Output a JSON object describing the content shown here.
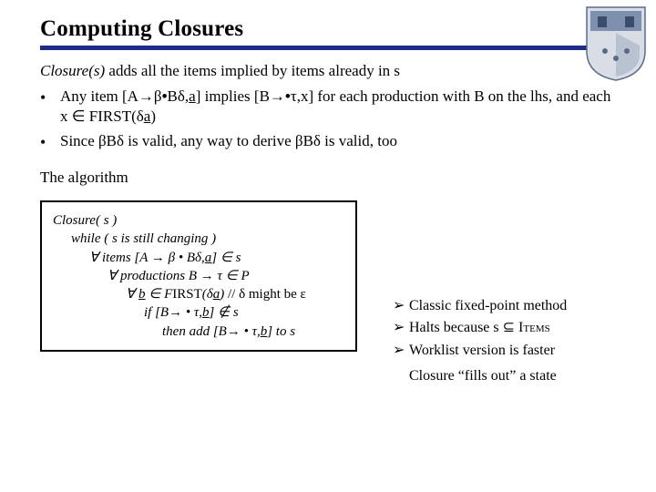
{
  "title": "Computing Closures",
  "intro_lead": "Closure(s)",
  "intro_rest": "  adds all the items implied by items already in s",
  "bullet1_a": "Any item [A→β",
  "bullet1_b": "•",
  "bullet1_c": "Bδ,",
  "bullet1_d": "a",
  "bullet1_e": "] implies [B→",
  "bullet1_f": "•",
  "bullet1_g": "τ,x] for each production with B on the lhs,  and each x ∈ FIRST(δ",
  "bullet1_h": "a",
  "bullet1_i": ")",
  "bullet2": "Since βBδ is valid, any way to derive βBδ is valid, too",
  "algo_heading": "The algorithm",
  "alg": {
    "l1": "Closure( s )",
    "l2": "while ( s is still changing )",
    "l3a": "∀ items [A → β • Bδ,",
    "l3b": "a",
    "l3c": "] ∈ s",
    "l4": "∀ productions B → τ ∈ P",
    "l5a": "∀ ",
    "l5b": "b",
    "l5c": " ∈ F",
    "l5d": "IRST",
    "l5e": "(δ",
    "l5f": "a",
    "l5g": ") ",
    "l5h": "// δ might be ε",
    "l6a": "if [B→ • τ,",
    "l6b": "b",
    "l6c": "] ∉ s",
    "l7a": "then add [B→ • τ,",
    "l7b": "b",
    "l7c": "] to s"
  },
  "notes": {
    "n1": "Classic fixed-point method",
    "n2a": "Halts because s ⊆ ",
    "n2b": "Items",
    "n3": "Worklist version is faster",
    "fill": "Closure “fills out” a state"
  }
}
